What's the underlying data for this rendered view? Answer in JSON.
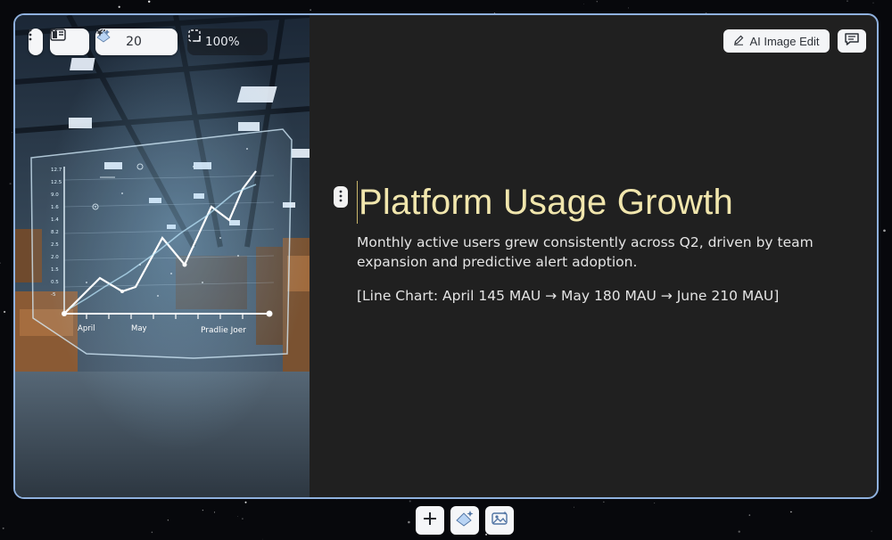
{
  "image_toolbar": {
    "credits_value": "20",
    "zoom_value": "100%"
  },
  "chart_overlay": {
    "labels": [
      "April",
      "May",
      "Pradlie Joer"
    ],
    "y_ticks": [
      "12.7",
      "12.5",
      "9.0",
      "1.6",
      "1.4",
      "8.2",
      "2.5",
      "2.0",
      "1.5",
      "0.5",
      "-5"
    ]
  },
  "content": {
    "title": "Platform Usage Growth",
    "body": "Monthly active users grew consistently across Q2, driven by team expansion and predictive alert adoption.",
    "chart_note": "[Line Chart: April 145 MAU → May 180 MAU → June 210 MAU]"
  },
  "actions": {
    "ai_edit_label": "AI Image Edit"
  },
  "icons": {
    "block_menu": "vertical-dots-icon",
    "layout": "layout-icon",
    "credits": "sparkle-icon",
    "crop": "crop-icon",
    "edit": "pencil-icon",
    "comment": "comment-icon",
    "add": "plus-icon",
    "ai_generate": "sparkle-icon",
    "image": "image-icon"
  },
  "colors": {
    "title": "#f1e6ad",
    "slide_border": "#8fb1de",
    "slide_bg": "#202020"
  }
}
